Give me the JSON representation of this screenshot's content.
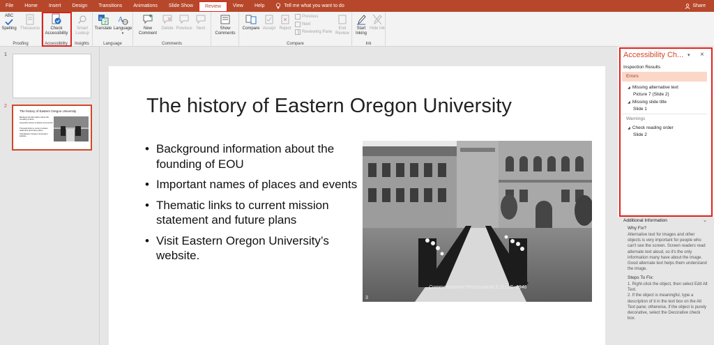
{
  "menu": {
    "tabs": [
      "File",
      "Home",
      "Insert",
      "Design",
      "Transitions",
      "Animations",
      "Slide Show",
      "Review",
      "View",
      "Help"
    ],
    "active": "Review",
    "tell_me": "Tell me what you want to do",
    "share": "Share"
  },
  "ribbon": {
    "spelling": "Spelling",
    "spelling_abc": "ABC",
    "thesaurus": "Thesaurus",
    "proofing": "Proofing",
    "check_accessibility": "Check Accessibility",
    "accessibility": "Accessibility",
    "smart_lookup": "Smart Lookup",
    "insights": "Insights",
    "translate": "Translate",
    "language_btn": "Language",
    "language": "Language",
    "new_comment": "New Comment",
    "delete": "Delete",
    "previous": "Previous",
    "next": "Next",
    "comments": "Comments",
    "show_comments": "Show Comments",
    "compare_btn": "Compare",
    "accept": "Accept",
    "reject": "Reject",
    "prev_small": "Previous",
    "next_small": "Next",
    "reviewing_pane": "Reviewing Pane",
    "end_review": "End Review",
    "compare": "Compare",
    "start_inking": "Start Inking",
    "hide_ink": "Hide Ink",
    "ink": "Ink"
  },
  "thumbnails": {
    "slide1_num": "1",
    "slide2_num": "2",
    "slide2_title": "The history of Eastern Oregon University",
    "slide2_bullets": [
      "Background information about the founding of EOU",
      "Important names of places and events",
      "Thematic links to current mission statement and future plans",
      "Visit Eastern Oregon University's website."
    ]
  },
  "slide": {
    "title": "The history of Eastern Oregon University",
    "bullets": [
      "Background information about the founding of EOU",
      "Important names of places and events",
      "Thematic links to current mission statement and future plans",
      "Visit Eastern Oregon University’s website."
    ],
    "photo_caption": "Commencement Processional E.O.C.E. 1946"
  },
  "accessibility_pane": {
    "title": "Accessibility Ch...",
    "inspection_results": "Inspection Results",
    "errors": "Errors",
    "error_items": [
      {
        "label": "Missing alternative text",
        "child": "Picture 7  (Slide 2)"
      },
      {
        "label": "Missing slide title",
        "child": "Slide 1"
      }
    ],
    "warnings": "Warnings",
    "warning_items": [
      {
        "label": "Check reading order",
        "child": "Slide 2"
      }
    ],
    "additional_info": "Additional Information",
    "why_fix": "Why Fix?",
    "why_fix_text": "Alternative text for images and other objects is very important for people who can't see the screen. Screen readers read alternate text aloud, so it's the only information many have about the image. Good alternate text helps them understand the image.",
    "steps": "Steps To Fix:",
    "steps_text": "1. Right-click the object, then select Edit Alt Text.\n2. If the object is meaningful, type a description of it in the text box on the Alt Text pane; otherwise, if the object is purely decorative, select the Decorative check box."
  },
  "colors": {
    "accent": "#b7472a",
    "highlight": "#e0201c",
    "error_bg": "#fbd7c8"
  }
}
